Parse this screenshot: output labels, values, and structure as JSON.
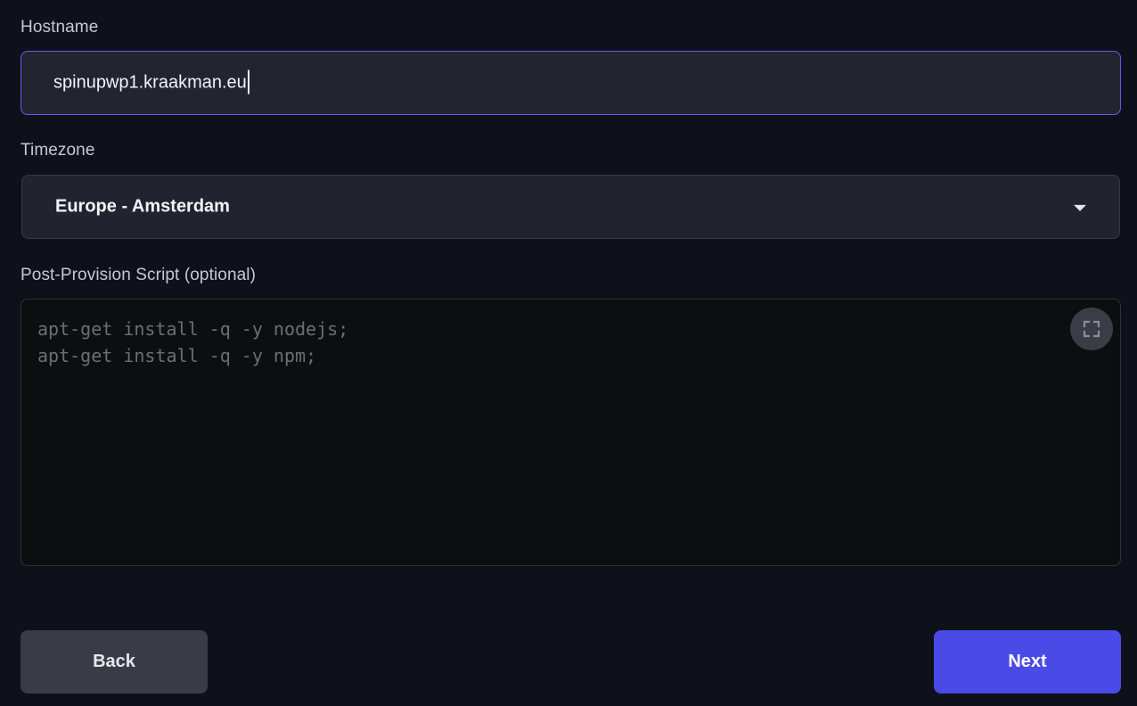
{
  "hostname": {
    "label": "Hostname",
    "value": "spinupwp1.kraakman.eu"
  },
  "timezone": {
    "label": "Timezone",
    "selected": "Europe - Amsterdam"
  },
  "script": {
    "label": "Post-Provision Script (optional)",
    "lines": [
      "apt-get install -q -y nodejs;",
      "apt-get install -q -y npm;"
    ],
    "fullscreen_icon": "fullscreen-icon"
  },
  "actions": {
    "back_label": "Back",
    "next_label": "Next"
  },
  "colors": {
    "background": "#0f111a",
    "accent": "#4a4be6",
    "focus_border": "#5b5ff0"
  }
}
